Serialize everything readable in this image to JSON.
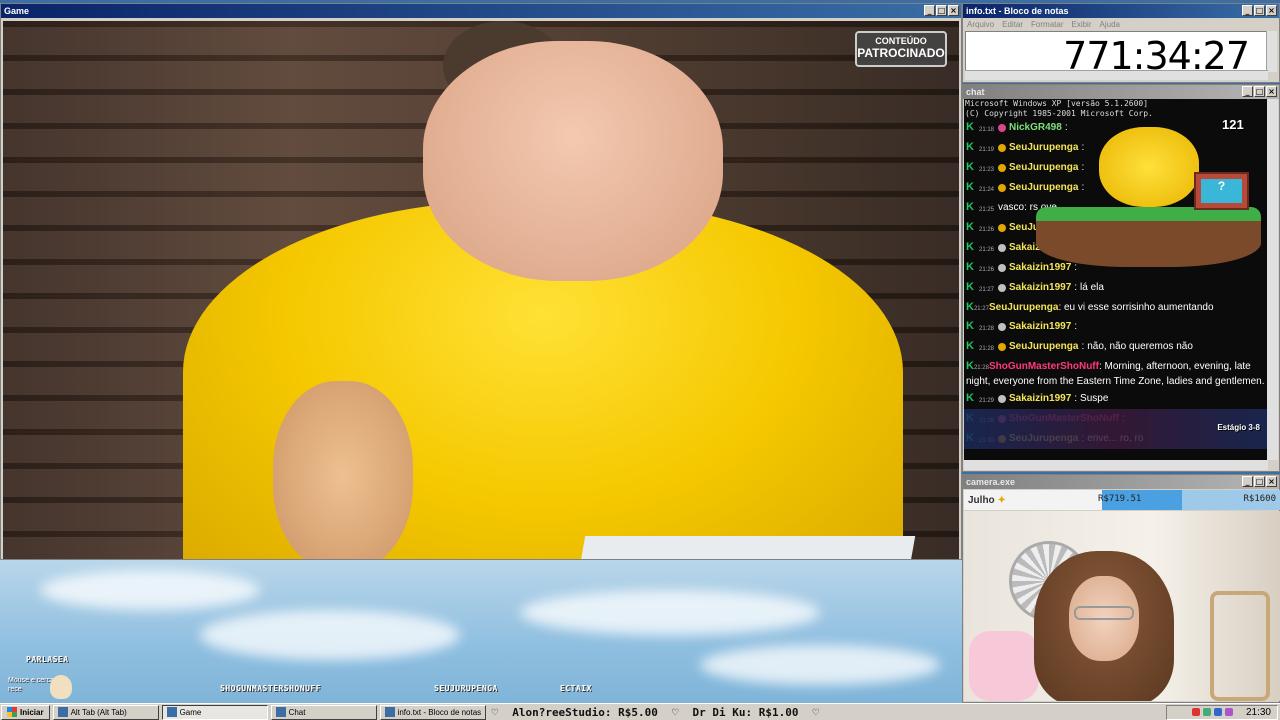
{
  "game_window": {
    "title": "Game",
    "sponsored_line1": "CONTEÚDO",
    "sponsored_line2": "PATROCINADO"
  },
  "desktop": {
    "labels": [
      "PARLASEA",
      "SHOGUNMASTERSHONUFF",
      "SEUJURUPENGA",
      "ECTAIX"
    ],
    "note": "Mouse e cerca\nrece"
  },
  "notepad": {
    "title": "info.txt - Bloco de notas",
    "menu": [
      "Arquivo",
      "Editar",
      "Formatar",
      "Exibir",
      "Ajuda"
    ],
    "content": "771:34:27"
  },
  "chat": {
    "title": "chat",
    "cmd_line1": "Microsoft Windows XP [versão 5.1.2600]",
    "cmd_line2": "(C) Copyright 1985-2001 Microsoft Corp.",
    "overlay_count": "121",
    "stage": "Estágio 3-8",
    "messages": [
      {
        "time": "21:18",
        "user": "NickGR498",
        "text": "",
        "badge": "p",
        "color": "g"
      },
      {
        "time": "21:19",
        "user": "SeuJurupenga",
        "text": "",
        "badge": "y",
        "color": ""
      },
      {
        "time": "21:23",
        "user": "SeuJurupenga",
        "text": "",
        "badge": "y",
        "color": ""
      },
      {
        "time": "21:24",
        "user": "SeuJurupenga",
        "text": "",
        "badge": "y",
        "color": ""
      },
      {
        "time": "21:25",
        "user": "",
        "text": "vasco: rs ove",
        "badge": "",
        "color": ""
      },
      {
        "time": "21:26",
        "user": "SeuJurupenga",
        "text": "",
        "badge": "y",
        "color": ""
      },
      {
        "time": "21:26",
        "user": "Sakaizin1997",
        "text": "",
        "badge": "g",
        "color": ""
      },
      {
        "time": "21:26",
        "user": "Sakaizin1997",
        "text": "",
        "badge": "g",
        "color": ""
      },
      {
        "time": "21:27",
        "user": "Sakaizin1997",
        "text": "lá ela",
        "badge": "g",
        "color": ""
      },
      {
        "time": "21:27",
        "user": "SeuJurupenga",
        "text": "eu vi esse sorrisinho aumentando",
        "badge": "y",
        "color": ""
      },
      {
        "time": "21:28",
        "user": "Sakaizin1997",
        "text": "",
        "badge": "g",
        "color": ""
      },
      {
        "time": "21:28",
        "user": "SeuJurupenga",
        "text": "não, não queremos não",
        "badge": "y",
        "color": ""
      },
      {
        "time": "21:28",
        "user": "ShoGunMasterShoNuff",
        "text": "Morning, afternoon, evening, late night, everyone from the Eastern Time Zone, ladies and gentlemen.",
        "badge": "p",
        "color": "red"
      },
      {
        "time": "21:29",
        "user": "Sakaizin1997",
        "text": "Suspe",
        "badge": "g",
        "color": ""
      },
      {
        "time": "21:29",
        "user": "ShoGunMasterShoNuff",
        "text": "",
        "badge": "p",
        "color": "red"
      },
      {
        "time": "21:30",
        "user": "SeuJurupenga",
        "text": "enve... ro, ro",
        "badge": "y",
        "color": ""
      }
    ]
  },
  "camera": {
    "title": "camera.exe",
    "month": "Julho",
    "current": "R$719.51",
    "goal": "R$1600",
    "progress": 0.45
  },
  "taskbar": {
    "start": "Iniciar",
    "tasks": [
      {
        "label": "Alt Tab (Alt Tab)",
        "active": false
      },
      {
        "label": "Game",
        "active": true
      },
      {
        "label": "Chat",
        "active": false
      },
      {
        "label": "info.txt - Bloco de notas",
        "active": false
      }
    ],
    "ticker": [
      "Alon?reeStudio: R$5.00",
      "Dr Di Ku: R$1.00"
    ],
    "clock": "21:30"
  }
}
